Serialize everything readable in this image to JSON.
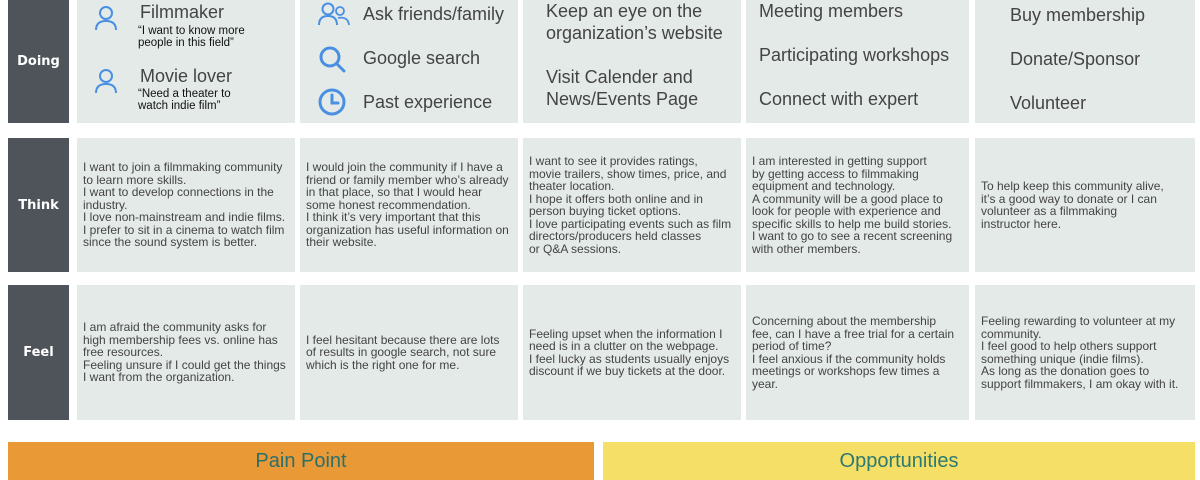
{
  "rows": {
    "doing": "Doing",
    "think": "Think",
    "feel": "Feel"
  },
  "doing": {
    "personas": [
      {
        "icon": "user-icon",
        "name": "Filmmaker",
        "quote": "“I want to know more\npeople in this field”"
      },
      {
        "icon": "user-icon",
        "name": "Movie lover",
        "quote": "“Need a theater to\nwatch indie film”"
      }
    ],
    "channels": [
      {
        "icon": "users-icon",
        "label": "Ask friends/family"
      },
      {
        "icon": "search-icon",
        "label": "Google search"
      },
      {
        "icon": "clock-icon",
        "label": "Past experience"
      }
    ],
    "website": [
      "Keep an eye on the\norganization’s website",
      "Visit Calender and\nNews/Events Page"
    ],
    "engage": [
      "Meeting members",
      "Participating workshops",
      "Connect with expert"
    ],
    "support": [
      "Buy membership",
      "Donate/Sponsor",
      "Volunteer"
    ]
  },
  "think": [
    "I want to join a filmmaking community\nto learn more skills.\nI want to develop connections in the\nindustry.\nI love non-mainstream and indie films.\nI prefer to sit in a cinema to watch film\nsince the sound system is better.",
    "I would join the community if I have a\nfriend or family member who’s already\nin that place, so that I would hear\nsome honest recommendation.\nI think it’s very important that this\norganization has useful information on\ntheir website.",
    "I want to see it provides ratings,\nmovie trailers, show times, price, and\ntheater location.\nI hope it offers both online and in\nperson buying ticket options.\nI love participating events such as film\ndirectors/producers held classes\nor Q&A sessions.",
    "I am interested in getting support\nby getting access to filmmaking\nequipment and technology.\nA community will be a good place to\nlook for people with experience and\nspecific skills to help me build stories.\nI want to go to see a recent screening\nwith other members.",
    "To help keep this community alive,\nit’s a good way to donate or I can\nvolunteer as a filmmaking\ninstructor here."
  ],
  "feel": [
    "I am afraid the community asks for\nhigh membership fees vs. online has\nfree resources.\nFeeling unsure if I could get the things\nI want from the organization.",
    "I feel hesitant because there are lots\nof results in google search, not sure\nwhich is the right one for me.",
    "Feeling upset when the information I\nneed is in a clutter on the webpage.\nI feel lucky as students usually enjoys\ndiscount if we buy tickets at the door.",
    "Concerning about the membership\nfee, can I have a free trial for a certain\nperiod of time?\nI feel anxious if the community holds\nmeetings or workshops few times a\nyear.",
    "Feeling rewarding to volunteer at my\ncommunity.\nI feel good to help others support\nsomething unique (indie films).\nAs long as the donation goes to\nsupport filmmakers, I am okay with it."
  ],
  "bars": {
    "pain_point": "Pain Point",
    "opportunities": "Opportunities"
  },
  "colors": {
    "label_bg": "#4e545a",
    "cell_bg": "#e4eae8",
    "icon_blue": "#4a90e2",
    "pain_bg": "#e99a37",
    "pain_text": "#2b6f6b",
    "opp_bg": "#f6df66",
    "opp_text": "#2b7a73"
  }
}
